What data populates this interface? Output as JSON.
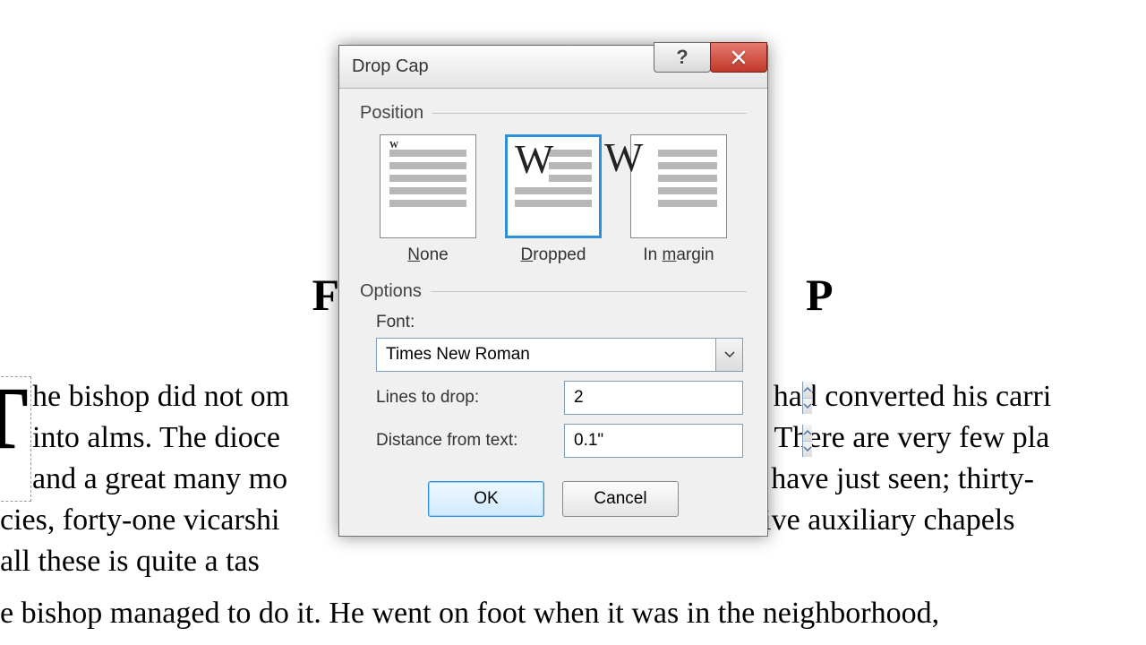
{
  "doc": {
    "title_left": "F",
    "title_right": "P",
    "dropcap": "T",
    "line1a": "he bishop did not om",
    "line1b": "he had converted his carri",
    "line2a": "into alms. The dioce",
    "line2b": "e. There are very few pla",
    "line3a": " and a great many mo",
    "line3b": "we have just seen; thirty-",
    "line4a": "cies, forty-one vicarshi",
    "line4b": "y-five auxiliary chapels",
    "line5a": "all these is quite a tas",
    "line6": "e bishop managed to do it. He went on foot when it was in the neighborhood,"
  },
  "dialog": {
    "title": "Drop Cap",
    "group_position": "Position",
    "group_options": "Options",
    "pos_none": "None",
    "pos_dropped": "Dropped",
    "pos_margin": "In margin",
    "font_label": "Font:",
    "font_value": "Times New Roman",
    "lines_label": "Lines to drop:",
    "lines_value": "2",
    "distance_label": "Distance from text:",
    "distance_value": "0.1\"",
    "ok": "OK",
    "cancel": "Cancel"
  }
}
